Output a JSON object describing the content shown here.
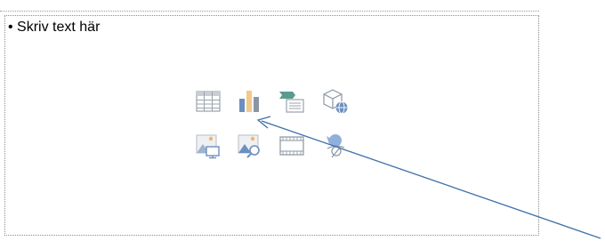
{
  "slide": {
    "placeholder_text": "• Skriv text här"
  },
  "content_icons": [
    {
      "name": "insert-table-icon"
    },
    {
      "name": "insert-chart-icon"
    },
    {
      "name": "insert-smartart-icon"
    },
    {
      "name": "insert-3d-model-icon"
    },
    {
      "name": "insert-picture-icon"
    },
    {
      "name": "online-pictures-icon"
    },
    {
      "name": "insert-video-icon"
    },
    {
      "name": "insert-icons-icon"
    }
  ],
  "colors": {
    "arrow": "#3f6fa8",
    "icon_gray": "#9aa3ad",
    "icon_blue": "#6d8fbf",
    "icon_orange": "#f2b469",
    "icon_teal": "#5b9b8e"
  }
}
